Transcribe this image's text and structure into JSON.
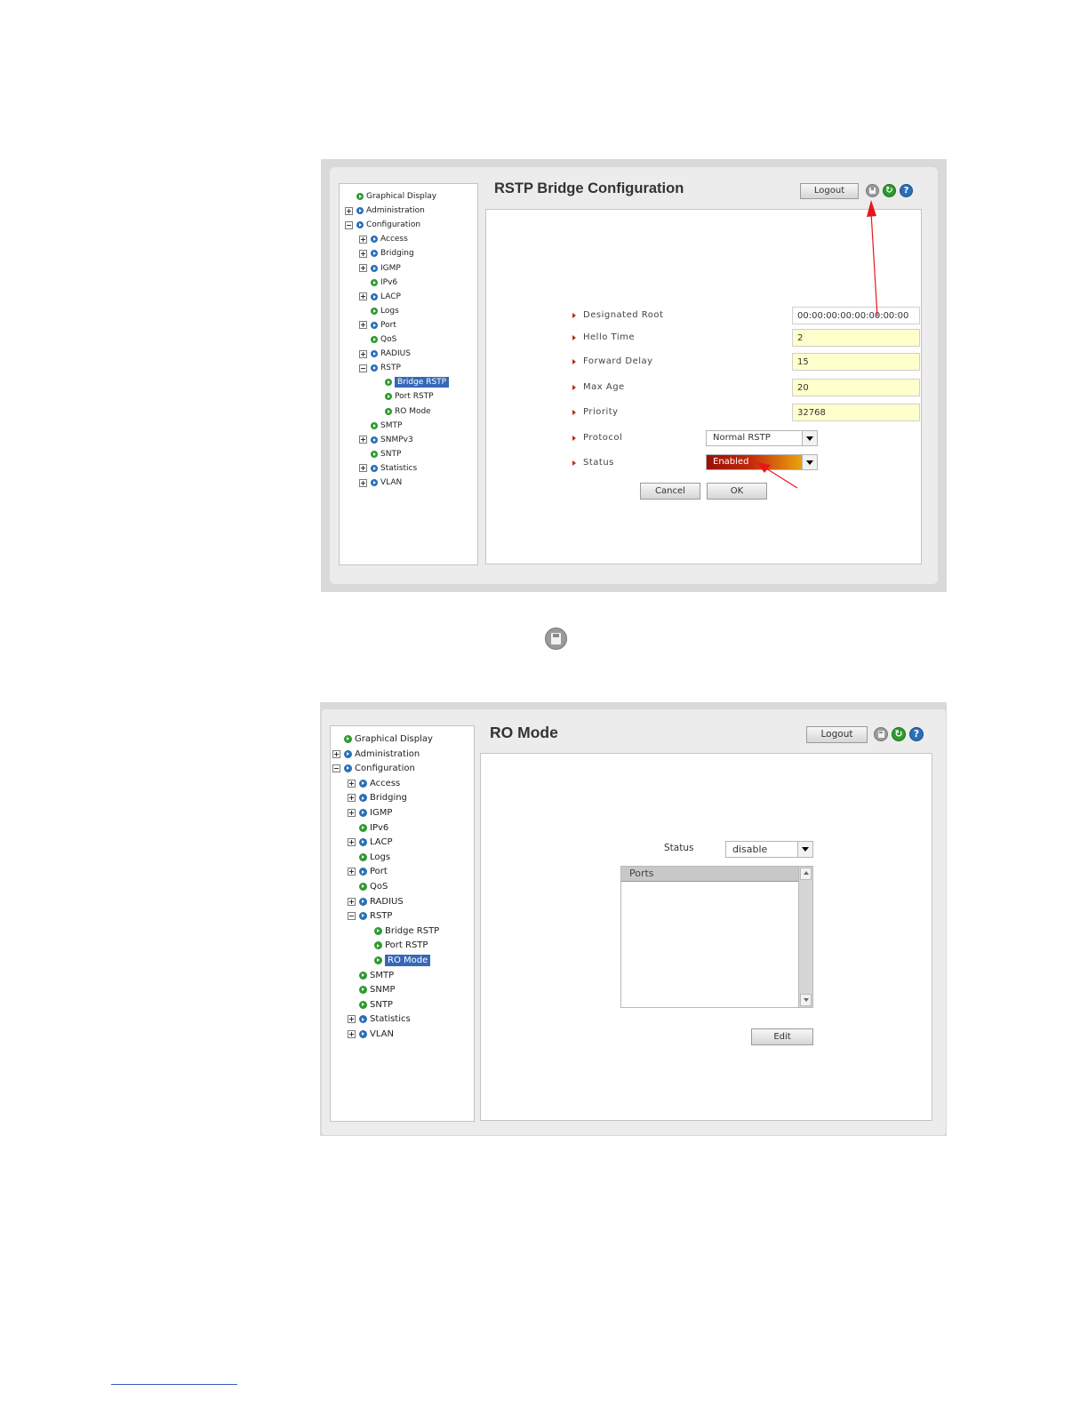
{
  "screenshot1": {
    "title": "RSTP Bridge Configuration",
    "logout_label": "Logout",
    "icons": [
      "save-icon",
      "refresh-icon",
      "help-icon"
    ],
    "tree": [
      {
        "label": "Graphical Display",
        "expander": "none",
        "bullet": "green"
      },
      {
        "label": "Administration",
        "expander": "plus",
        "bullet": "blue"
      },
      {
        "label": "Configuration",
        "expander": "minus",
        "bullet": "blue"
      },
      {
        "label": "Access",
        "expander": "plus",
        "bullet": "blue"
      },
      {
        "label": "Bridging",
        "expander": "plus",
        "bullet": "blue"
      },
      {
        "label": "IGMP",
        "expander": "plus",
        "bullet": "blue"
      },
      {
        "label": "IPv6",
        "expander": "none",
        "bullet": "green"
      },
      {
        "label": "LACP",
        "expander": "plus",
        "bullet": "blue"
      },
      {
        "label": "Logs",
        "expander": "none",
        "bullet": "green"
      },
      {
        "label": "Port",
        "expander": "plus",
        "bullet": "blue"
      },
      {
        "label": "QoS",
        "expander": "none",
        "bullet": "green"
      },
      {
        "label": "RADIUS",
        "expander": "plus",
        "bullet": "blue"
      },
      {
        "label": "RSTP",
        "expander": "minus",
        "bullet": "blue"
      },
      {
        "label": "Bridge RSTP",
        "expander": "none",
        "bullet": "green",
        "selected": true
      },
      {
        "label": "Port RSTP",
        "expander": "none",
        "bullet": "green"
      },
      {
        "label": "RO Mode",
        "expander": "none",
        "bullet": "green"
      },
      {
        "label": "SMTP",
        "expander": "none",
        "bullet": "green"
      },
      {
        "label": "SNMPv3",
        "expander": "plus",
        "bullet": "blue"
      },
      {
        "label": "SNTP",
        "expander": "none",
        "bullet": "green"
      },
      {
        "label": "Statistics",
        "expander": "plus",
        "bullet": "blue"
      },
      {
        "label": "VLAN",
        "expander": "plus",
        "bullet": "blue"
      }
    ],
    "form": {
      "designated_root_label": "Designated Root",
      "designated_root_value": "00:00:00:00:00:00:00:00",
      "hello_time_label": "Hello Time",
      "hello_time_value": "2",
      "forward_delay_label": "Forward Delay",
      "forward_delay_value": "15",
      "max_age_label": "Max Age",
      "max_age_value": "20",
      "priority_label": "Priority",
      "priority_value": "32768",
      "protocol_label": "Protocol",
      "protocol_value": "Normal RSTP",
      "status_label": "Status",
      "status_value": "Enabled"
    },
    "cancel_label": "Cancel",
    "ok_label": "OK",
    "annotation_color": "#e8161b"
  },
  "screenshot2": {
    "title": "RO Mode",
    "logout_label": "Logout",
    "icons": [
      "save-icon",
      "refresh-icon",
      "help-icon"
    ],
    "tree": [
      {
        "label": "Graphical Display",
        "expander": "none",
        "bullet": "green"
      },
      {
        "label": "Administration",
        "expander": "plus",
        "bullet": "blue"
      },
      {
        "label": "Configuration",
        "expander": "minus",
        "bullet": "blue"
      },
      {
        "label": "Access",
        "expander": "plus",
        "bullet": "blue"
      },
      {
        "label": "Bridging",
        "expander": "plus",
        "bullet": "blue"
      },
      {
        "label": "IGMP",
        "expander": "plus",
        "bullet": "blue"
      },
      {
        "label": "IPv6",
        "expander": "none",
        "bullet": "green"
      },
      {
        "label": "LACP",
        "expander": "plus",
        "bullet": "blue"
      },
      {
        "label": "Logs",
        "expander": "none",
        "bullet": "green"
      },
      {
        "label": "Port",
        "expander": "plus",
        "bullet": "blue"
      },
      {
        "label": "QoS",
        "expander": "none",
        "bullet": "green"
      },
      {
        "label": "RADIUS",
        "expander": "plus",
        "bullet": "blue"
      },
      {
        "label": "RSTP",
        "expander": "minus",
        "bullet": "blue"
      },
      {
        "label": "Bridge RSTP",
        "expander": "none",
        "bullet": "green"
      },
      {
        "label": "Port RSTP",
        "expander": "none",
        "bullet": "green"
      },
      {
        "label": "RO Mode",
        "expander": "none",
        "bullet": "green",
        "selected": true
      },
      {
        "label": "SMTP",
        "expander": "none",
        "bullet": "green"
      },
      {
        "label": "SNMP",
        "expander": "none",
        "bullet": "green"
      },
      {
        "label": "SNTP",
        "expander": "none",
        "bullet": "green"
      },
      {
        "label": "Statistics",
        "expander": "plus",
        "bullet": "blue"
      },
      {
        "label": "VLAN",
        "expander": "plus",
        "bullet": "blue"
      }
    ],
    "status_label": "Status",
    "status_value": "disable",
    "ports_header": "Ports",
    "edit_label": "Edit"
  },
  "standalone_icon": "save-icon"
}
